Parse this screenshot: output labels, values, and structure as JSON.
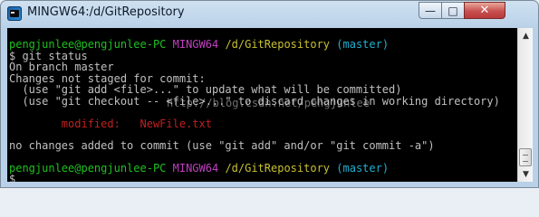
{
  "window": {
    "title": "MINGW64:/d/GitRepository",
    "minimize": "—",
    "maximize": "□",
    "close": "✕"
  },
  "terminal": {
    "prompt1": {
      "user": "pengjunlee@pengjunlee-PC",
      "env": "MINGW64",
      "path": "/d/GitRepository",
      "branch": "(master)"
    },
    "cmd": "$ git status",
    "l1": "On branch master",
    "l2": "Changes not staged for commit:",
    "l3": "  (use \"git add <file>...\" to update what will be committed)",
    "l4": "  (use \"git checkout -- <file>...\" to discard changes in working directory)",
    "mod_label": "        modified:   ",
    "mod_file": "NewFile.txt",
    "l6": "no changes added to commit (use \"git add\" and/or \"git commit -a\")",
    "prompt2": {
      "user": "pengjunlee@pengjunlee-PC",
      "env": "MINGW64",
      "path": "/d/GitRepository",
      "branch": "(master)"
    },
    "last": "$",
    "watermark": "http://blog.csdn.net/pengjunlee"
  },
  "scrollbar": {
    "up": "▲",
    "down": "▼"
  }
}
